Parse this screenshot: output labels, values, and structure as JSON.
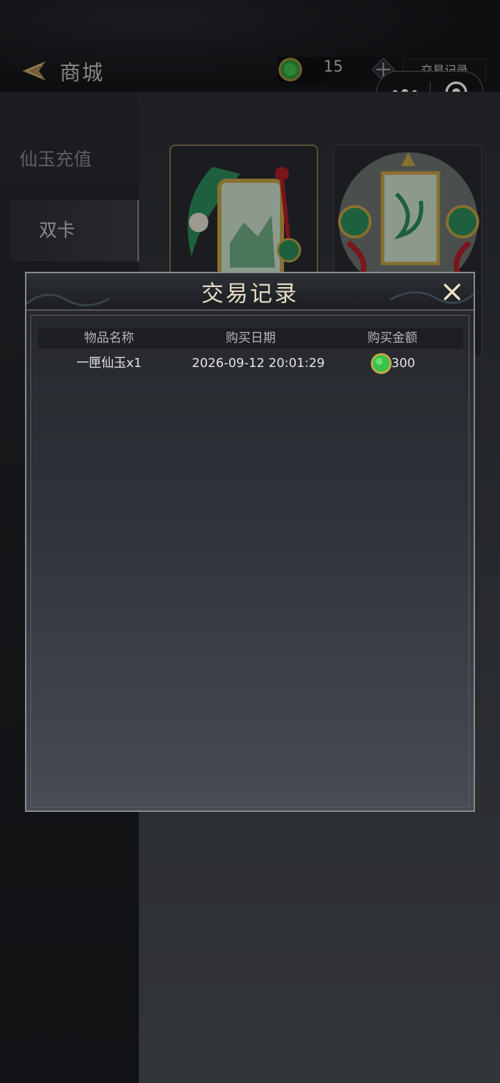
{
  "header": {
    "title": "商城",
    "coins": "15",
    "records_button": "交易记录"
  },
  "sidebar": {
    "items": [
      {
        "label": "仙玉充值"
      },
      {
        "label": "双卡"
      }
    ]
  },
  "modal": {
    "title": "交易记录",
    "columns": [
      "物品名称",
      "购买日期",
      "购买金额"
    ],
    "rows": [
      {
        "item": "一匣仙玉x1",
        "date": "2026-09-12 20:01:29",
        "amount": "-300"
      }
    ]
  },
  "colors": {
    "accent_gold": "#e6dcc4",
    "jade_green": "#3fbf4c",
    "coin_rim": "#c9a548"
  },
  "icons": {
    "back": "back-arrow-icon",
    "coin": "jade-coin-icon",
    "add": "plus-icon",
    "more": "more-dots-icon",
    "target": "target-icon",
    "close": "close-icon"
  }
}
